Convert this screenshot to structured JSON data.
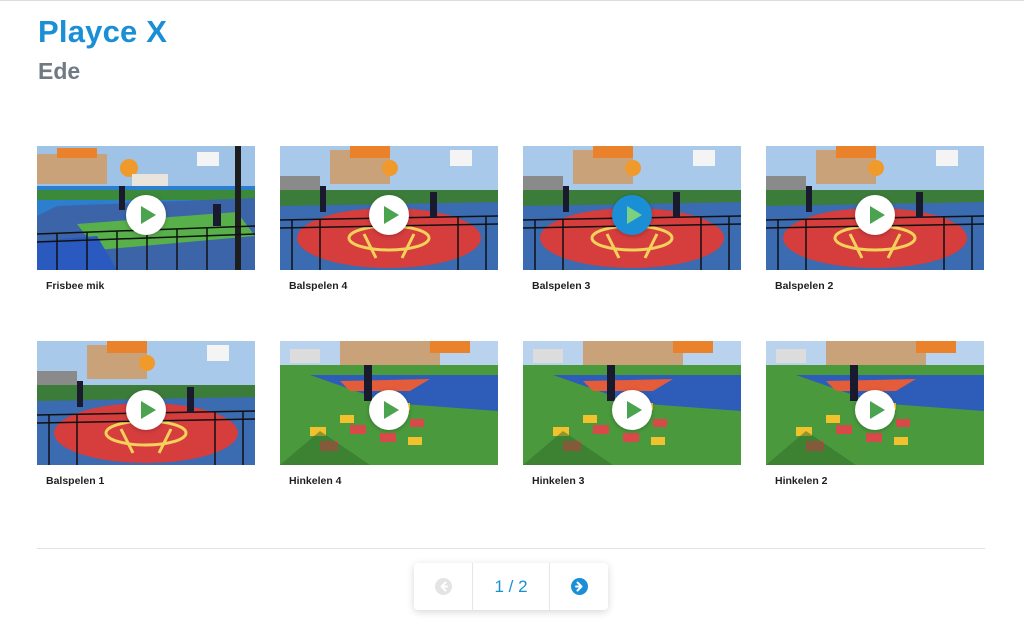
{
  "header": {
    "title": "Playce X",
    "subtitle": "Ede"
  },
  "videos": [
    {
      "title": "Frisbee mik",
      "scene": "frisbee",
      "active": false
    },
    {
      "title": "Balspelen 4",
      "scene": "ball",
      "active": false
    },
    {
      "title": "Balspelen 3",
      "scene": "ball",
      "active": true
    },
    {
      "title": "Balspelen 2",
      "scene": "ball",
      "active": false
    },
    {
      "title": "Balspelen 1",
      "scene": "ball",
      "active": false
    },
    {
      "title": "Hinkelen 4",
      "scene": "hop",
      "active": false
    },
    {
      "title": "Hinkelen 3",
      "scene": "hop",
      "active": false
    },
    {
      "title": "Hinkelen 2",
      "scene": "hop",
      "active": false
    }
  ],
  "pagination": {
    "label": "1 / 2",
    "prev_icon": "arrow-left-circle-icon",
    "next_icon": "arrow-right-circle-icon",
    "prev_disabled": true
  },
  "colors": {
    "accent": "#1a8fd6",
    "subtitle": "#6f7a85",
    "play_triangle": "#4aa34f"
  }
}
